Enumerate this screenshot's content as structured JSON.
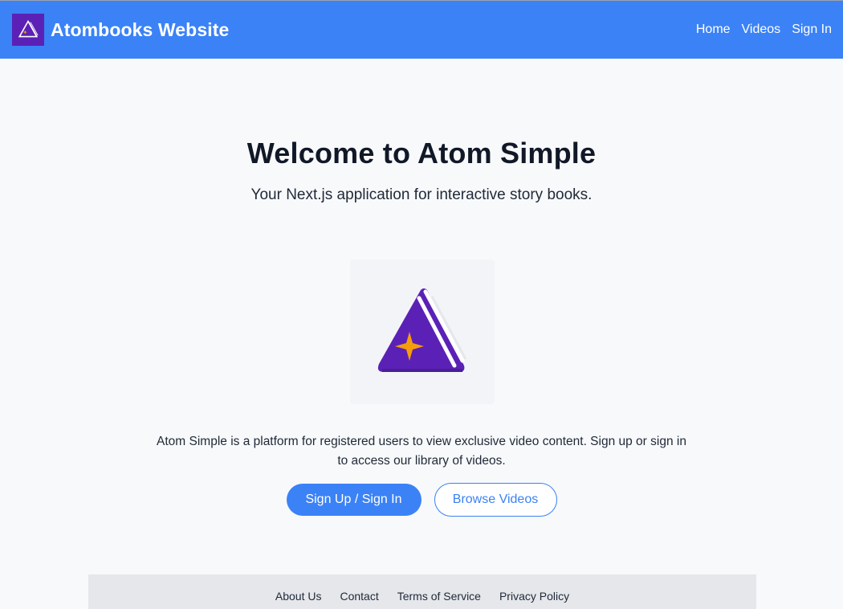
{
  "header": {
    "brand_title": "Atombooks Website",
    "nav": [
      {
        "label": "Home"
      },
      {
        "label": "Videos"
      },
      {
        "label": "Sign In"
      }
    ]
  },
  "hero": {
    "title": "Welcome to Atom Simple",
    "subtitle": "Your Next.js application for interactive story books."
  },
  "main": {
    "description": "Atom Simple is a platform for registered users to view exclusive video content. Sign up or sign in to access our library of videos.",
    "primary_button": "Sign Up / Sign In",
    "secondary_button": "Browse Videos"
  },
  "footer": {
    "links": [
      {
        "label": "About Us"
      },
      {
        "label": "Contact"
      },
      {
        "label": "Terms of Service"
      },
      {
        "label": "Privacy Policy"
      }
    ]
  },
  "colors": {
    "navbar": "#3b82f6",
    "accent": "#3b82f6",
    "logo_purple": "#5b21b6",
    "star_orange": "#f59e0b",
    "footer_bg": "#e5e7eb"
  },
  "icons": {
    "brand_logo": "atombooks-logo-icon",
    "hero_logo": "atombooks-logo-icon"
  }
}
